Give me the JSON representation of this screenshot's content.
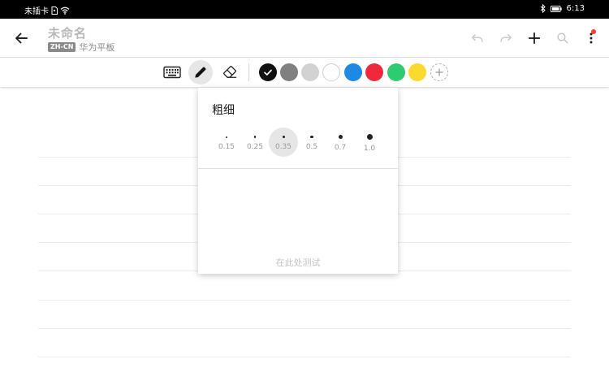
{
  "status_bar": {
    "carrier": "未插卡",
    "time": "6:13"
  },
  "header": {
    "title": "未命名",
    "lang_badge": "ZH-CN",
    "device": "华为平板"
  },
  "toolbar": {
    "tools": [
      {
        "name": "keyboard",
        "icon": "keyboard-icon",
        "active": false
      },
      {
        "name": "pen",
        "icon": "pencil-icon",
        "active": true
      },
      {
        "name": "eraser",
        "icon": "eraser-icon",
        "active": false
      }
    ],
    "colors": [
      {
        "hex": "#111111",
        "selected": true
      },
      {
        "hex": "#808080",
        "selected": false
      },
      {
        "hex": "#d2d2d2",
        "selected": false
      },
      {
        "hex": "#ffffff",
        "selected": false
      },
      {
        "hex": "#1e88e5",
        "selected": false
      },
      {
        "hex": "#f0283c",
        "selected": false
      },
      {
        "hex": "#2ecc71",
        "selected": false
      },
      {
        "hex": "#fcd92e",
        "selected": false
      }
    ],
    "add_color_icon": "plus-circle-icon"
  },
  "stroke_popover": {
    "title": "粗细",
    "sizes": [
      {
        "label": "0.15",
        "selected": false
      },
      {
        "label": "0.25",
        "selected": false
      },
      {
        "label": "0.35",
        "selected": true
      },
      {
        "label": "0.5",
        "selected": false
      },
      {
        "label": "0.7",
        "selected": false
      },
      {
        "label": "1.0",
        "selected": false
      }
    ],
    "test_hint": "在此处测试"
  }
}
